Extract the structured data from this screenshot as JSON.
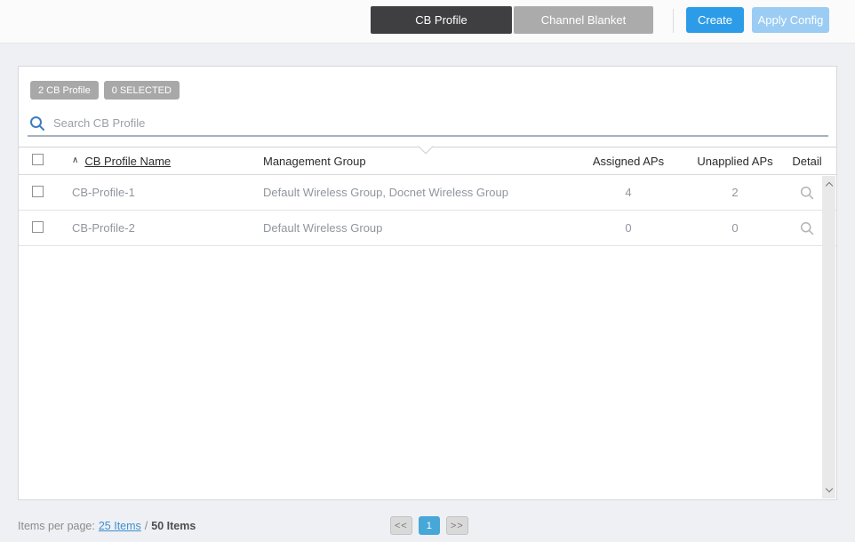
{
  "toolbar": {
    "tabs": [
      {
        "label": "CB Profile",
        "active": true
      },
      {
        "label": "Channel Blanket",
        "active": false
      }
    ],
    "create_label": "Create",
    "apply_config_label": "Apply Config",
    "apply_config_enabled": false
  },
  "panel": {
    "badges": {
      "count_badge": "2 CB Profile",
      "selected_badge": "0 SELECTED"
    },
    "search": {
      "placeholder": "Search CB Profile",
      "value": ""
    }
  },
  "table": {
    "sort_indicator": "∧",
    "headers": {
      "name": "CB Profile Name",
      "management_group": "Management Group",
      "assigned_aps": "Assigned APs",
      "unapplied_aps": "Unapplied APs",
      "detail": "Detail"
    },
    "rows": [
      {
        "name": "CB-Profile-1",
        "management_group": "Default Wireless Group, Docnet Wireless Group",
        "assigned_aps": "4",
        "unapplied_aps": "2"
      },
      {
        "name": "CB-Profile-2",
        "management_group": "Default Wireless Group",
        "assigned_aps": "0",
        "unapplied_aps": "0"
      }
    ]
  },
  "footer": {
    "items_per_page_label": "Items per page:",
    "per_page_link": "25 Items",
    "separator": "/",
    "total_label": "50 Items",
    "pagination": {
      "prev": "<<",
      "current_page": "1",
      "next": ">>"
    }
  },
  "colors": {
    "create_button": "#2d9ce8",
    "apply_button_disabled": "#9bccf3",
    "active_tab": "#3f3f41",
    "inactive_tab": "#ababab",
    "active_page": "#47a8d8",
    "link": "#3d8fd1",
    "search_underline": "#a6b2c0"
  }
}
